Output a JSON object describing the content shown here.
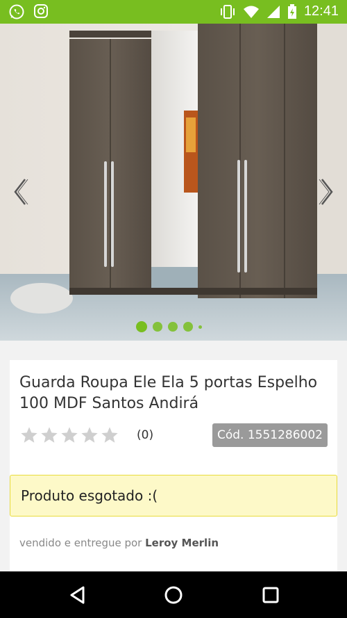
{
  "status_bar": {
    "time": "12:41",
    "icons_left": [
      "whatsapp-icon",
      "instagram-icon"
    ],
    "icons_right": [
      "vibrate-icon",
      "wifi-icon",
      "signal-icon",
      "battery-icon"
    ],
    "color": "#78be20"
  },
  "gallery": {
    "prev_icon": "chevron-left-icon",
    "next_icon": "chevron-right-icon",
    "total_slides": 5,
    "active_slide": 1,
    "dot_color": "#78be20"
  },
  "product": {
    "title": "Guarda Roupa Ele Ela 5 portas Espelho 100 MDF Santos Andirá",
    "rating_stars": 0,
    "rating_max": 5,
    "rating_count": "(0)",
    "sku": "Cód. 1551286002",
    "stock_message": "Produto esgotado :(",
    "seller_prefix": "vendido e entregue por",
    "seller_name": "Leroy Merlin"
  },
  "system_nav": {
    "buttons": [
      "back-icon",
      "home-icon",
      "recents-icon"
    ]
  }
}
